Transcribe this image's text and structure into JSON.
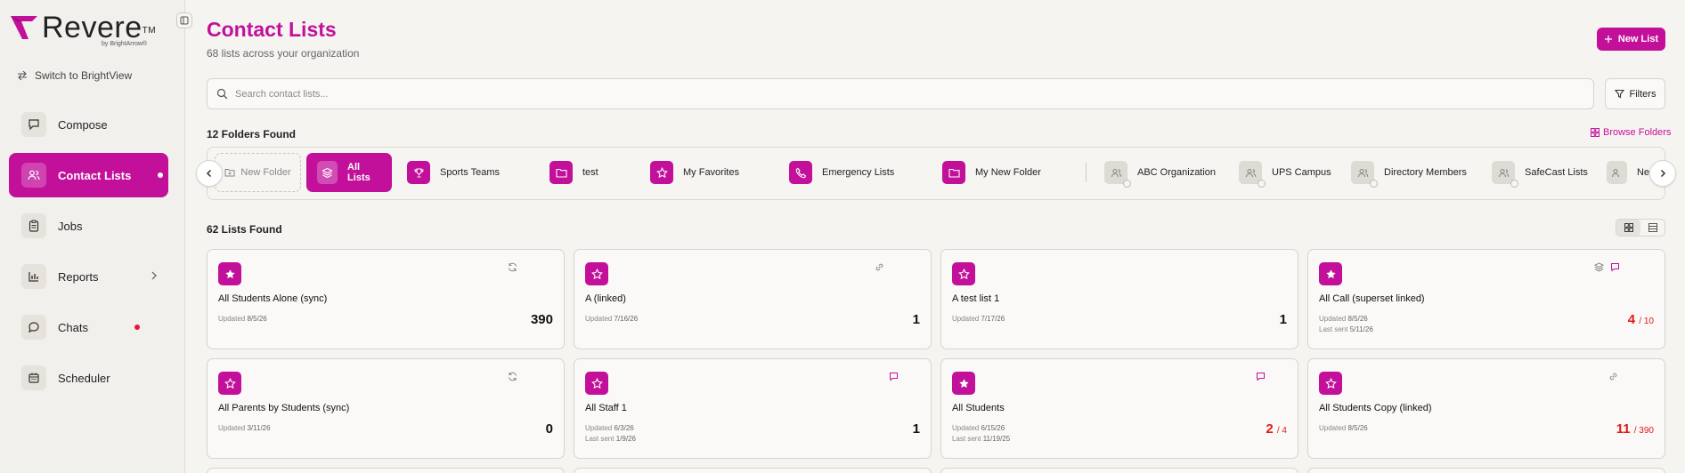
{
  "brand": {
    "name": "Revere",
    "tm": "TM",
    "sub": "by BrightArrow®"
  },
  "switch_label": "Switch to BrightView",
  "nav": [
    {
      "label": "Compose",
      "icon": "compose-icon"
    },
    {
      "label": "Contact Lists",
      "icon": "contacts-icon",
      "active": true
    },
    {
      "label": "Jobs",
      "icon": "clipboard-icon"
    },
    {
      "label": "Reports",
      "icon": "bar-chart-icon"
    },
    {
      "label": "Chats",
      "icon": "chat-icon"
    },
    {
      "label": "Scheduler",
      "icon": "calendar-icon"
    }
  ],
  "header": {
    "title": "Contact Lists",
    "subtitle": "68 lists across your organization",
    "new_list": "New List"
  },
  "search": {
    "placeholder": "Search contact lists..."
  },
  "filters_label": "Filters",
  "folders": {
    "found": "12 Folders Found",
    "browse": "Browse Folders",
    "new_folder": "New Folder",
    "items": [
      {
        "label": "All Lists",
        "icon": "layers-icon"
      },
      {
        "label": "Sports Teams",
        "icon": "trophy-icon"
      },
      {
        "label": "test",
        "icon": "folder-icon"
      },
      {
        "label": "My Favorites",
        "icon": "star-icon"
      },
      {
        "label": "Emergency Lists",
        "icon": "phone-icon"
      },
      {
        "label": "My New Folder",
        "icon": "folder-icon"
      },
      {
        "label": "ABC Organization",
        "icon": "users-icon"
      },
      {
        "label": "UPS Campus",
        "icon": "users-icon"
      },
      {
        "label": "Directory Members",
        "icon": "users-icon"
      },
      {
        "label": "SafeCast Lists",
        "icon": "users-icon"
      },
      {
        "label": "Ne",
        "icon": "users-icon"
      }
    ]
  },
  "lists": {
    "found": "62 Lists Found",
    "cards": [
      {
        "name": "All Students Alone (sync)",
        "updated_label": "Updated",
        "updated": "8/5/26",
        "count": "390",
        "tag": "sync-icon"
      },
      {
        "name": "A (linked)",
        "updated_label": "Updated",
        "updated": "7/16/26",
        "count": "1",
        "tag": "link-icon"
      },
      {
        "name": "A test list 1",
        "updated_label": "Updated",
        "updated": "7/17/26",
        "count": "1"
      },
      {
        "name": "All Call (superset linked)",
        "updated_label": "Updated",
        "updated": "8/5/26",
        "sent_label": "Last sent",
        "sent": "5/11/26",
        "count": "4",
        "of": "/ 10",
        "tag": "layers-chat-icon"
      },
      {
        "name": "All Parents by Students (sync)",
        "updated_label": "Updated",
        "updated": "3/11/26",
        "count": "0",
        "tag": "sync-icon"
      },
      {
        "name": "All Staff 1",
        "updated_label": "Updated",
        "updated": "6/3/26",
        "sent_label": "Last sent",
        "sent": "1/9/26",
        "count": "1",
        "tag": "chat-icon"
      },
      {
        "name": "All Students",
        "updated_label": "Updated",
        "updated": "6/15/26",
        "sent_label": "Last sent",
        "sent": "11/19/25",
        "count": "2",
        "of": "/ 4",
        "tag": "chat-icon"
      },
      {
        "name": "All Students Copy (linked)",
        "updated_label": "Updated",
        "updated": "8/5/26",
        "count": "11",
        "of": "/ 390",
        "tag": "link-icon"
      }
    ]
  },
  "colors": {
    "accent": "#c2109a",
    "alert": "#e01b1b"
  }
}
